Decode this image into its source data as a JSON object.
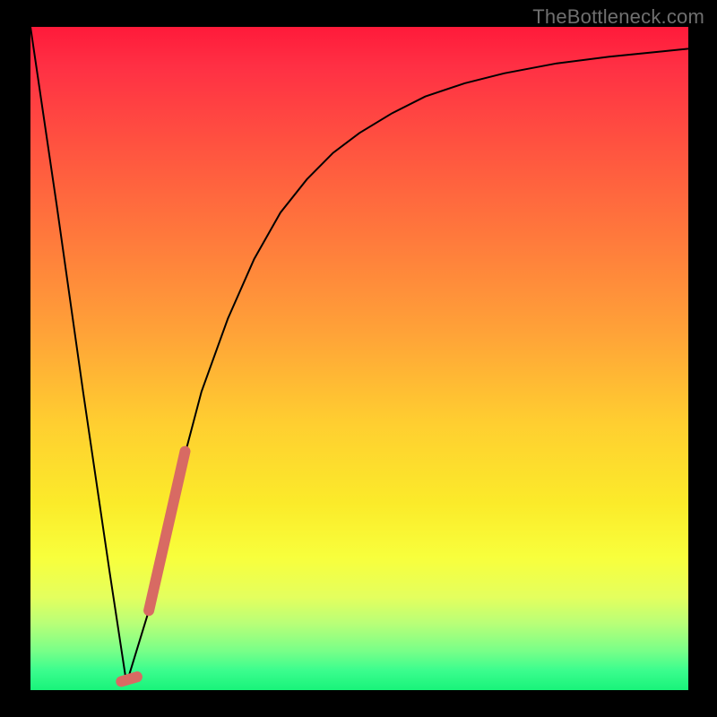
{
  "watermark": "TheBottleneck.com",
  "chart_data": {
    "type": "line",
    "title": "",
    "xlabel": "",
    "ylabel": "",
    "xlim": [
      0,
      100
    ],
    "ylim": [
      0,
      100
    ],
    "series": [
      {
        "name": "bottleneck-curve",
        "color": "#000000",
        "stroke_width": 2,
        "x": [
          0,
          4,
          8,
          12,
          14.6,
          18,
          22,
          26,
          30,
          34,
          38,
          42,
          46,
          50,
          55,
          60,
          66,
          72,
          80,
          88,
          96,
          100
        ],
        "values": [
          100,
          73,
          45,
          18,
          1,
          12,
          30,
          45,
          56,
          65,
          72,
          77,
          81,
          84,
          87,
          89.5,
          91.5,
          93,
          94.5,
          95.5,
          96.3,
          96.7
        ]
      },
      {
        "name": "highlight-segment",
        "color": "#d86a63",
        "stroke_width": 12,
        "linecap": "round",
        "x": [
          18.0,
          23.5
        ],
        "values": [
          12.0,
          36.0
        ]
      },
      {
        "name": "highlight-dot",
        "color": "#d86a63",
        "stroke_width": 12,
        "linecap": "round",
        "x": [
          13.8,
          16.2
        ],
        "values": [
          1.3,
          2.0
        ]
      }
    ]
  }
}
